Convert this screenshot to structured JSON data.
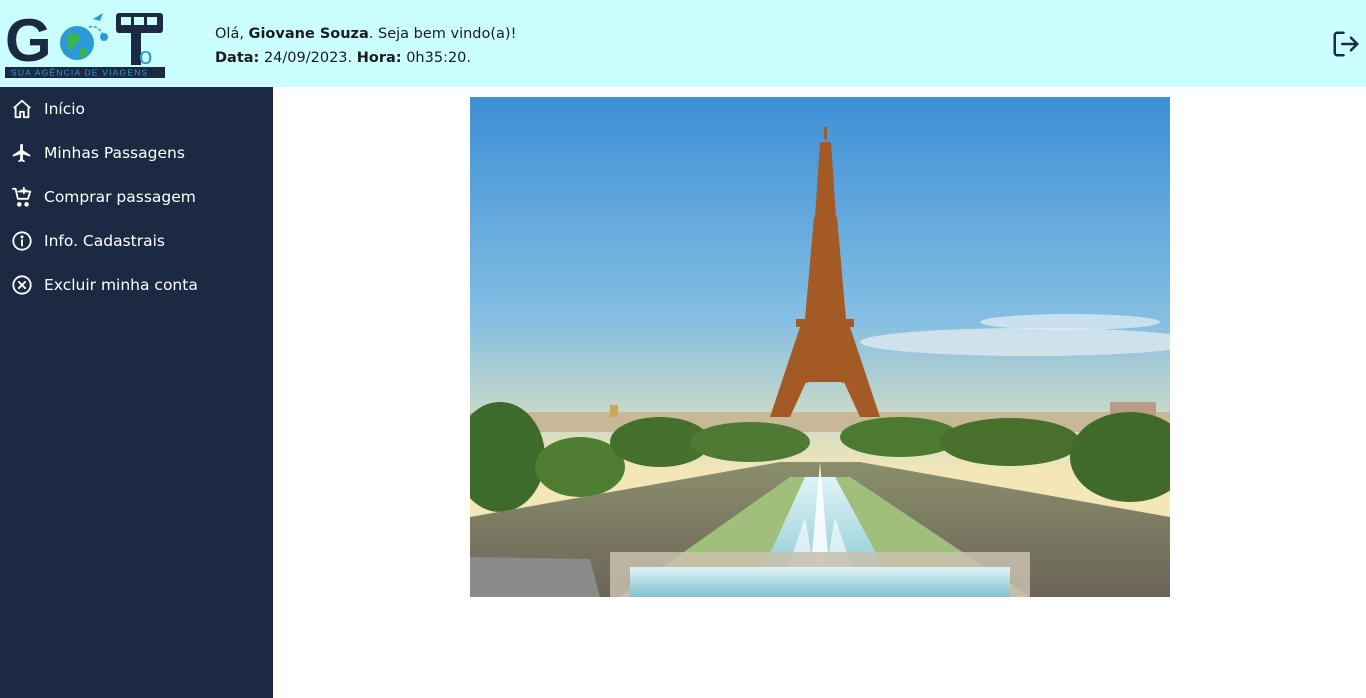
{
  "header": {
    "logo": {
      "wordmark": "GoTo",
      "tagline": "SUA AGÊNCIA DE VIAGENS",
      "icon": "globe-plane-bus-logo"
    },
    "greeting": {
      "hello": "Olá,",
      "user_name": "Giovane Souza",
      "welcome": ". Seja bem vindo(a)!",
      "date_label": "Data:",
      "date_value": "24/09/2023.",
      "time_label": "Hora:",
      "time_value": "0h35:20."
    },
    "logout_icon": "logout-icon"
  },
  "sidebar": {
    "items": [
      {
        "label": "Início",
        "icon": "home-icon"
      },
      {
        "label": "Minhas Passagens",
        "icon": "airplane-icon"
      },
      {
        "label": "Comprar passagem",
        "icon": "cart-add-icon"
      },
      {
        "label": "Info. Cadastrais",
        "icon": "info-icon"
      },
      {
        "label": "Excluir minha conta",
        "icon": "close-circle-icon"
      }
    ]
  },
  "main": {
    "hero_image": "eiffel-tower-photo"
  },
  "colors": {
    "header_bg": "#cbfeff",
    "sidebar_bg": "#1b2a42",
    "sidebar_text": "#ffffff",
    "logo_blue": "#2a9bd8",
    "logo_green": "#3bb54a"
  }
}
